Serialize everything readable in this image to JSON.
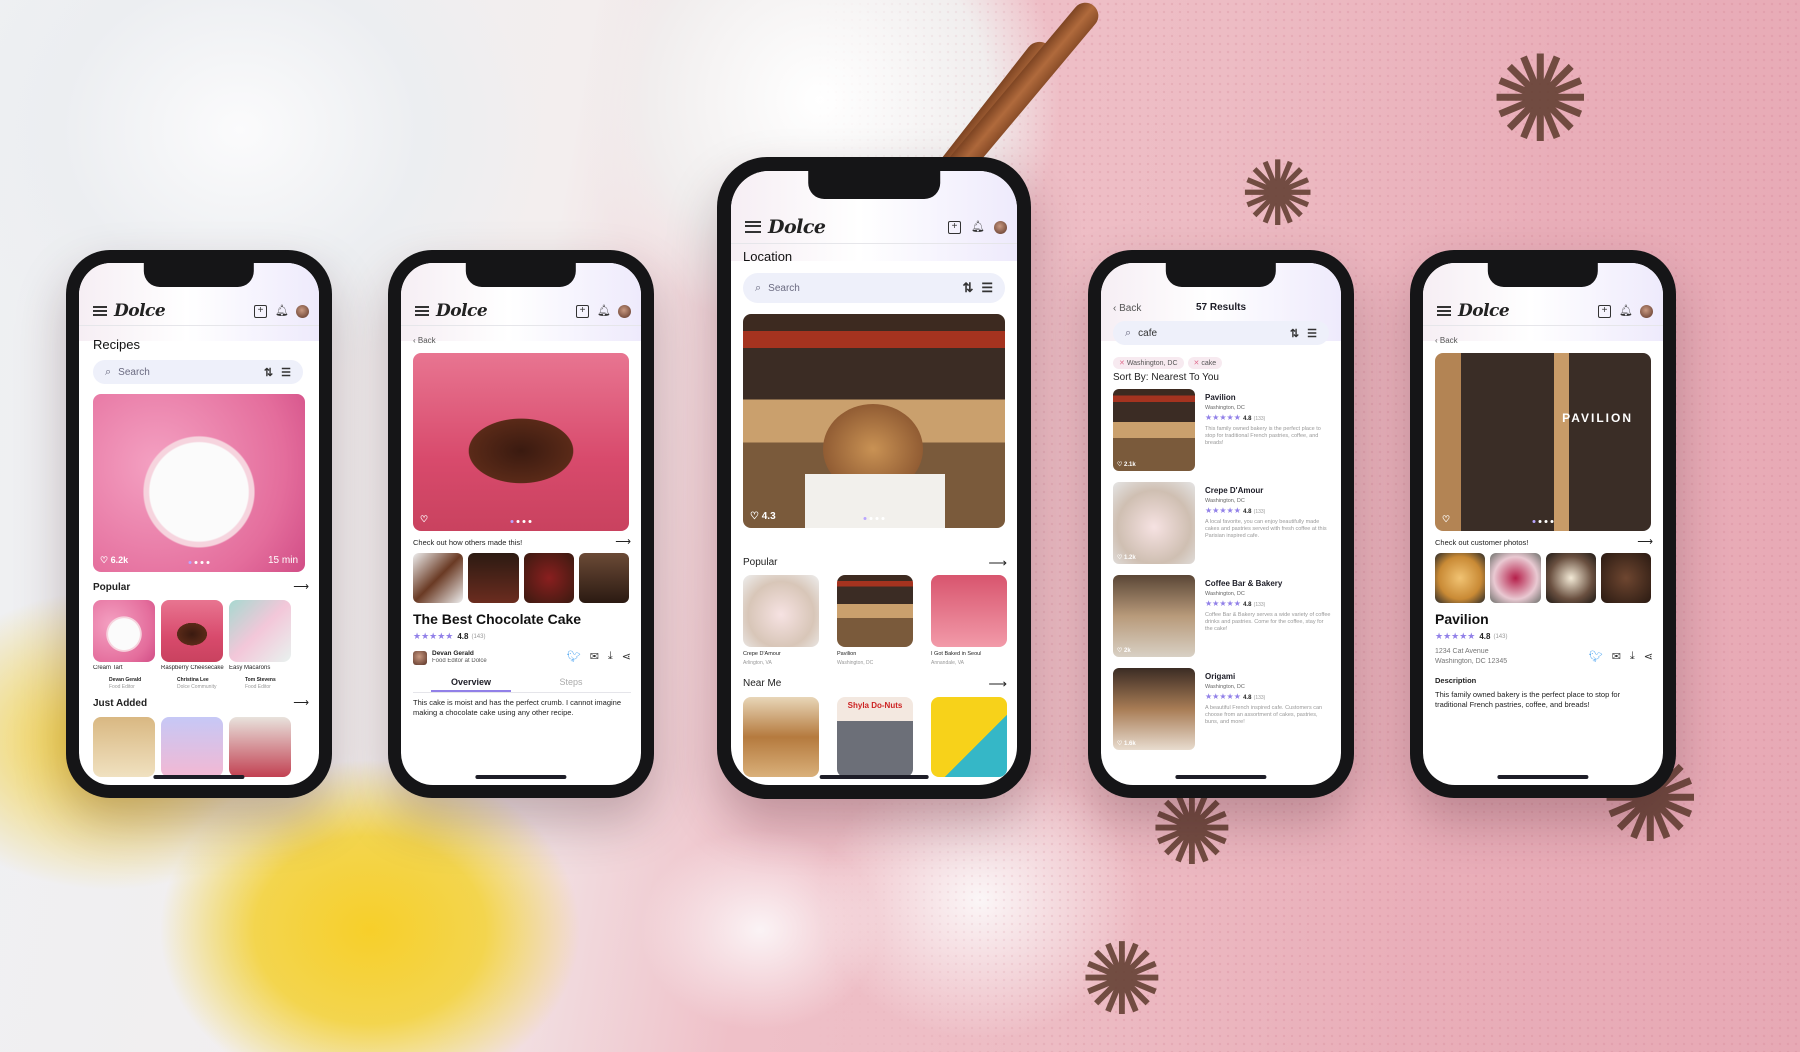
{
  "brand": {
    "logo": "Dolce",
    "accent": "#9180e8",
    "bg_pink": "#e9aeb9"
  },
  "icons": {
    "menu": "menu-icon",
    "add": "add-square-icon",
    "bell": "bell-icon",
    "avatar": "avatar",
    "search": "search-icon",
    "sort": "sort-icon",
    "filter": "filter-icon",
    "heart": "heart-icon",
    "arrow": "arrow-right-icon",
    "twitter": "twitter-icon",
    "mail": "mail-icon",
    "download": "download-icon",
    "share": "share-icon"
  },
  "p1": {
    "heading": "Recipes",
    "search_placeholder": "Search",
    "hero_likes": "6.2k",
    "hero_time": "15 min",
    "popular": "Popular",
    "items": [
      {
        "name": "Cream Tart",
        "author": "Devan Gerald",
        "role": "Food Editor"
      },
      {
        "name": "Raspberry Cheesecake",
        "author": "Christina Lee",
        "role": "Dolce Community"
      },
      {
        "name": "Easy Macarons",
        "author": "Tom Stevens",
        "role": "Food Editor"
      }
    ],
    "just_added": "Just Added"
  },
  "p2": {
    "back": "Back",
    "check_out": "Check out how others made this!",
    "title": "The Best Chocolate Cake",
    "rating": "4.8",
    "count": "(143)",
    "author": "Devan Gerald",
    "role": "Food Editor at Dolce",
    "tab_overview": "Overview",
    "tab_steps": "Steps",
    "body": "This cake is moist and has the perfect crumb. I cannot imagine making a chocolate cake using any other recipe."
  },
  "p3": {
    "heading": "Location",
    "search_placeholder": "Search",
    "hero_likes": "4.3",
    "popular": "Popular",
    "items": [
      {
        "name": "Crepe D'Amour",
        "loc": "Arlington, VA"
      },
      {
        "name": "Pavilion",
        "loc": "Washington, DC"
      },
      {
        "name": "I Got Baked in Seoul",
        "loc": "Annandale, VA"
      }
    ],
    "near_me": "Near Me",
    "sign": "Shyla Do-Nuts"
  },
  "p4": {
    "back": "Back",
    "results": "57 Results",
    "query": "cafe",
    "chips": [
      "Washington, DC",
      "cake"
    ],
    "sort": "Sort By: Nearest To You",
    "results_list": [
      {
        "name": "Pavilion",
        "loc": "Washington, DC",
        "rating": "4.8",
        "count": "(133)",
        "desc": "This family owned bakery is the perfect place to stop for traditional French pastries, coffee, and breads!",
        "likes": "2.1k"
      },
      {
        "name": "Crepe D'Amour",
        "loc": "Washington, DC",
        "rating": "4.8",
        "count": "(133)",
        "desc": "A local favorite, you can enjoy beautifully made cakes and pastries served with fresh coffee at this Parisian inspired cafe.",
        "likes": "1.2k"
      },
      {
        "name": "Coffee Bar & Bakery",
        "loc": "Washington, DC",
        "rating": "4.8",
        "count": "(133)",
        "desc": "Coffee Bar & Bakery serves a wide variety of coffee drinks and pastries. Come for the coffee, stay for the cake!",
        "likes": "2k"
      },
      {
        "name": "Origami",
        "loc": "Washington, DC",
        "rating": "4.8",
        "count": "(133)",
        "desc": "A beautiful French inspired cafe. Customers can choose from an assortment of cakes, pastries, buns, and more!",
        "likes": "1.6k"
      }
    ]
  },
  "p5": {
    "back": "Back",
    "sign": "PAVILION",
    "check_out": "Check out customer photos!",
    "title": "Pavilion",
    "rating": "4.8",
    "count": "(143)",
    "address1": "1234 Cat Avenue",
    "address2": "Washington, DC 12345",
    "desc_heading": "Description",
    "desc": "This family owned bakery is the perfect place to stop for traditional French pastries, coffee, and breads!"
  }
}
